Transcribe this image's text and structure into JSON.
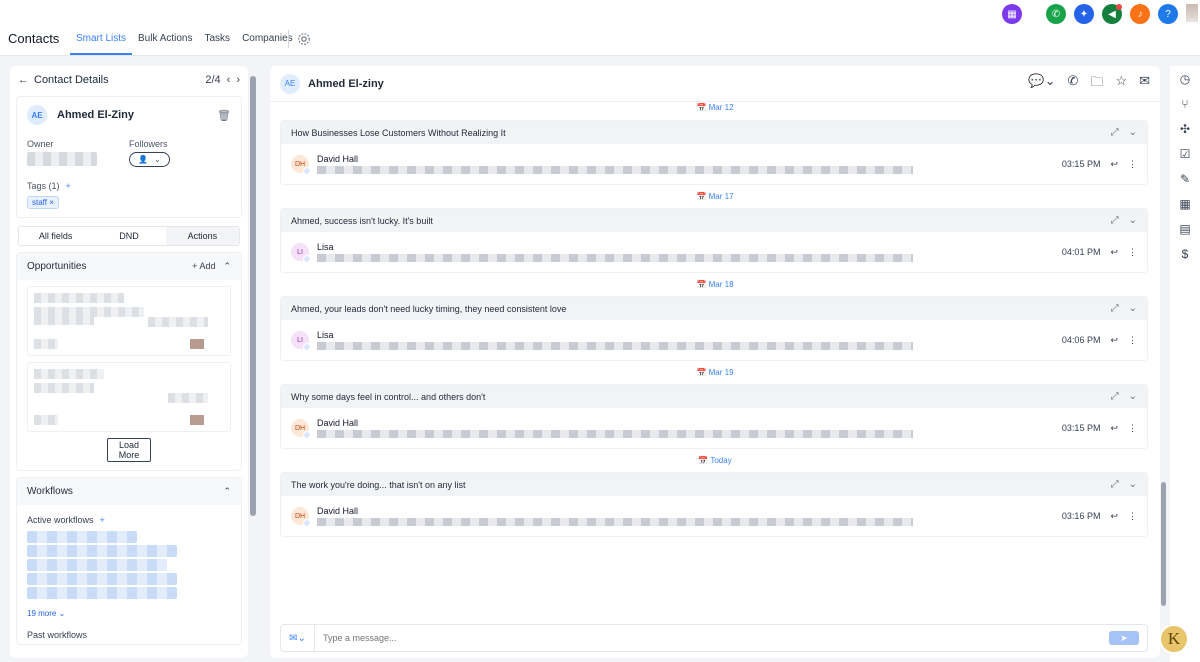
{
  "topbar": {
    "title": "Contacts",
    "tabs": [
      "Smart Lists",
      "Bulk Actions",
      "Tasks",
      "Companies"
    ],
    "active_tab": "Smart Lists",
    "icons": [
      {
        "name": "app-launcher-icon",
        "color": "#7c3aed"
      },
      {
        "name": "phone-icon",
        "color": "#16a34a"
      },
      {
        "name": "magic-icon",
        "color": "#2563eb"
      },
      {
        "name": "megaphone-icon",
        "color": "#15803d"
      },
      {
        "name": "bell-icon",
        "color": "#f97316"
      },
      {
        "name": "help-icon",
        "color": "#1d7ae8"
      }
    ]
  },
  "left": {
    "header": "Contact Details",
    "pager": "2/4",
    "contact": {
      "initials": "AE",
      "name": "Ahmed El-Ziny"
    },
    "owner_label": "Owner",
    "followers_label": "Followers",
    "tags_label": "Tags (1)",
    "tag": "staff",
    "tabs": [
      "All fields",
      "DND",
      "Actions"
    ],
    "opportunities": {
      "title": "Opportunities",
      "add": "Add",
      "load_more": "Load More"
    },
    "workflows": {
      "title": "Workflows",
      "active": "Active workflows",
      "more": "19 more",
      "past": "Past workflows"
    }
  },
  "mid": {
    "header": {
      "initials": "AE",
      "name": "Ahmed El-ziny"
    },
    "top_date": "Mar 12",
    "conversations": [
      {
        "subject": "How Businesses Lose Customers Without Realizing It",
        "sender": "David Hall",
        "time": "03:15 PM",
        "avatar": "dh",
        "date_after": "Mar 17"
      },
      {
        "subject": "Ahmed, success isn't lucky. It's built",
        "sender": "Lisa",
        "time": "04:01 PM",
        "avatar": "li",
        "date_after": "Mar 18"
      },
      {
        "subject": "Ahmed, your leads don't need lucky timing, they need consistent love",
        "sender": "Lisa",
        "time": "04:06 PM",
        "avatar": "li",
        "date_after": "Mar 19"
      },
      {
        "subject": "Why some days feel in control... and others don't",
        "sender": "David Hall",
        "time": "03:15 PM",
        "avatar": "dh",
        "date_after": "Today"
      },
      {
        "subject": "The work you're doing... that isn't on any list",
        "sender": "David Hall",
        "time": "03:16 PM",
        "avatar": "dh",
        "date_after": ""
      }
    ],
    "composer_placeholder": "Type a message..."
  },
  "rail": [
    "clock-icon",
    "flow-icon",
    "apps-icon",
    "task-icon",
    "pen-icon",
    "calendar-icon",
    "document-icon",
    "dollar-icon"
  ],
  "badge": "K"
}
